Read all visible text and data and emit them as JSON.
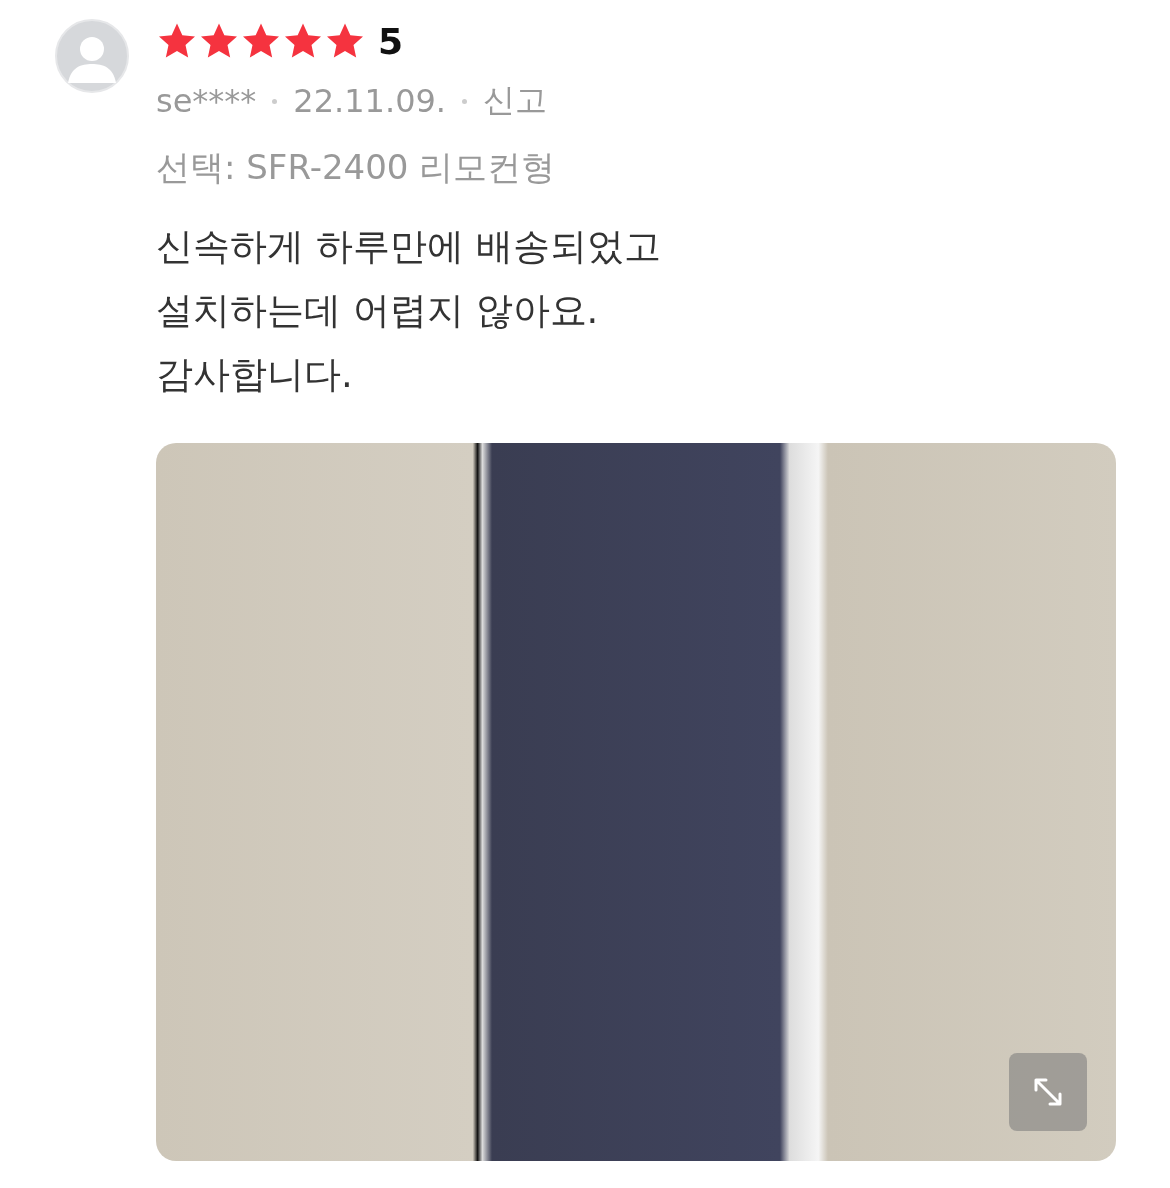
{
  "review": {
    "stars": 5,
    "rating": "5",
    "author": "se****",
    "date": "22.11.09.",
    "report": "신고",
    "option": "선택: SFR-2400 리모컨형",
    "text": "신속하게 하루만에 배송되었고\n설치하는데 어렵지 않아요.\n감사합니다."
  }
}
